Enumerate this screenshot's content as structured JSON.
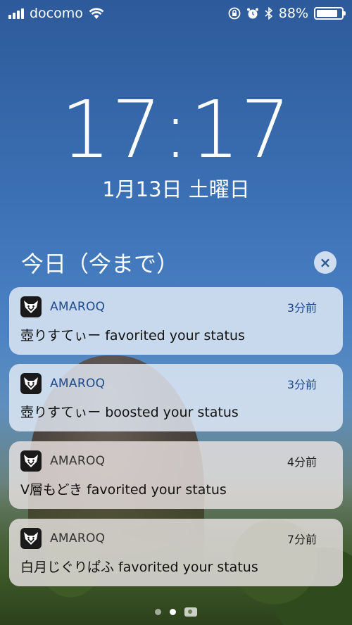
{
  "status_bar": {
    "carrier": "docomo",
    "battery_percent": "88%",
    "battery_level": 0.88,
    "icons": [
      "signal-icon",
      "wifi-icon",
      "rotation-lock-icon",
      "alarm-icon",
      "bluetooth-icon",
      "battery-icon"
    ]
  },
  "lock_screen": {
    "time": "17:17",
    "date": "1月13日 土曜日"
  },
  "section": {
    "title": "今日（今まで）",
    "clear_icon": "×"
  },
  "notifications": [
    {
      "app": "AMAROQ",
      "time": "3分前",
      "body": "壺りすてぃー favorited your status"
    },
    {
      "app": "AMAROQ",
      "time": "3分前",
      "body": "壺りすてぃー boosted your status"
    },
    {
      "app": "AMAROQ",
      "time": "4分前",
      "body": "V層もどき favorited your status"
    },
    {
      "app": "AMAROQ",
      "time": "7分前",
      "body": "白月じぐりぱふ favorited your status"
    }
  ],
  "page_indicator": {
    "pages": 2,
    "active": 1
  }
}
